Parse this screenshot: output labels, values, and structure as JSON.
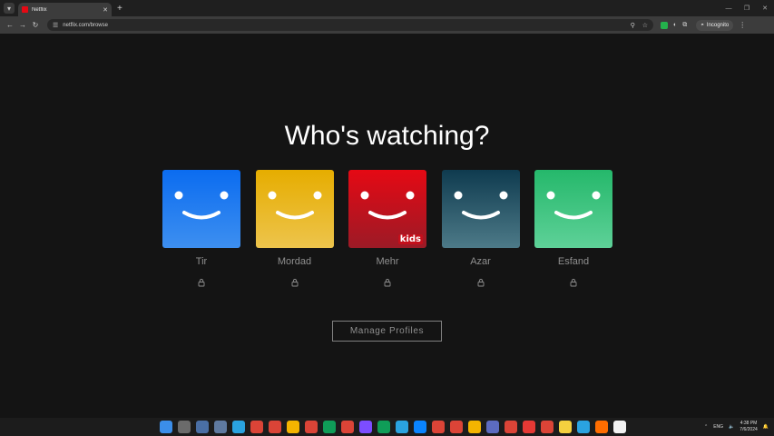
{
  "browser": {
    "tab_title": "Netflix",
    "url": "netflix.com/browse",
    "incognito_label": "Incognito"
  },
  "page": {
    "heading": "Who's watching?",
    "profiles": [
      {
        "name": "Tir",
        "color_top": "#0b6cf0",
        "color_bottom": "#3d8ff0",
        "kids": false
      },
      {
        "name": "Mordad",
        "color_top": "#e6ad00",
        "color_bottom": "#edc44c",
        "kids": false
      },
      {
        "name": "Mehr",
        "color_top": "#e50914",
        "color_bottom": "#9c1a26",
        "kids": true,
        "kids_label": "kids"
      },
      {
        "name": "Azar",
        "color_top": "#0f3b4f",
        "color_bottom": "#4d7a88",
        "kids": false
      },
      {
        "name": "Esfand",
        "color_top": "#25b86b",
        "color_bottom": "#5ed198",
        "kids": false
      }
    ],
    "manage_label": "Manage Profiles"
  },
  "taskbar": {
    "language": "ENG",
    "time": "4:38 PM",
    "date": "7/6/2024"
  }
}
